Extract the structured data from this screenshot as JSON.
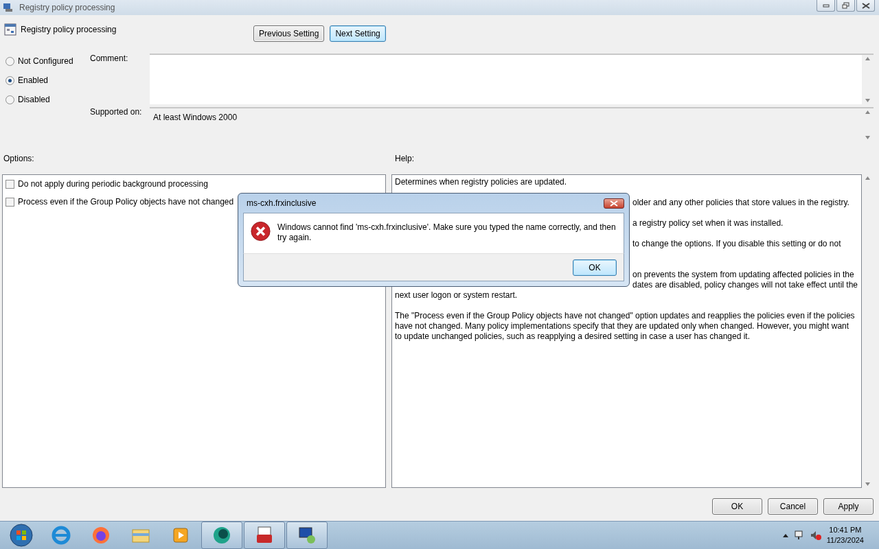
{
  "window": {
    "title": "Registry policy processing"
  },
  "header": {
    "title": "Registry policy processing"
  },
  "nav_buttons": [
    {
      "label": "Previous Setting",
      "focused": false
    },
    {
      "label": "Next Setting",
      "focused": true
    }
  ],
  "state_options": [
    {
      "label": "Not Configured",
      "selected": false
    },
    {
      "label": "Enabled",
      "selected": true
    },
    {
      "label": "Disabled",
      "selected": false
    }
  ],
  "comment": {
    "label": "Comment:"
  },
  "supported_on": {
    "label": "Supported on:",
    "value": "At least Windows 2000"
  },
  "options": {
    "label": "Options:",
    "items": [
      {
        "label": "Do not apply during periodic background processing",
        "checked": false
      },
      {
        "label": "Process even if the Group Policy objects have not changed",
        "checked": false
      }
    ]
  },
  "help": {
    "label": "Help:",
    "paragraphs": [
      {
        "lines": [
          {
            "text": "Determines when registry policies are updated.",
            "covered": false
          }
        ]
      },
      {
        "lines": [
          {
            "text": "older and any other policies that store values in the registry.",
            "covered": true
          }
        ]
      },
      {
        "lines": [
          {
            "text": "a registry policy set when it was installed.",
            "covered": true
          }
        ]
      },
      {
        "lines": [
          {
            "text": "to change the options. If you disable this setting or do not",
            "covered": true
          }
        ],
        "line_hidden_below": true
      },
      {
        "lines": [
          {
            "text": "on prevents the system from updating affected policies in the",
            "covered": true
          },
          {
            "text": "dates are disabled, policy changes will not take effect until the",
            "covered": true
          },
          {
            "text": "next user logon or system restart.",
            "covered": false
          }
        ]
      },
      {
        "lines": [
          {
            "text": "The \"Process even if the Group Policy objects have not changed\" option updates and reapplies the policies even if the policies",
            "covered": false
          },
          {
            "text": "have not changed. Many policy implementations specify that they are updated only when changed. However, you might want",
            "covered": false
          },
          {
            "text": "to update unchanged policies, such as reapplying a desired setting in case a user has changed it.",
            "covered": false
          }
        ]
      }
    ]
  },
  "footer_buttons": [
    {
      "label": "OK",
      "focused": false
    },
    {
      "label": "Cancel",
      "focused": false
    },
    {
      "label": "Apply",
      "focused": false
    }
  ],
  "dialog": {
    "title": "ms-cxh.frxinclusive",
    "message": "Windows cannot find 'ms-cxh.frxinclusive'. Make sure you typed the name correctly, and then try again.",
    "button": {
      "label": "OK",
      "focused": true
    }
  },
  "taskbar": {
    "clock": {
      "time": "10:41 PM",
      "date": "11/23/2024"
    }
  }
}
